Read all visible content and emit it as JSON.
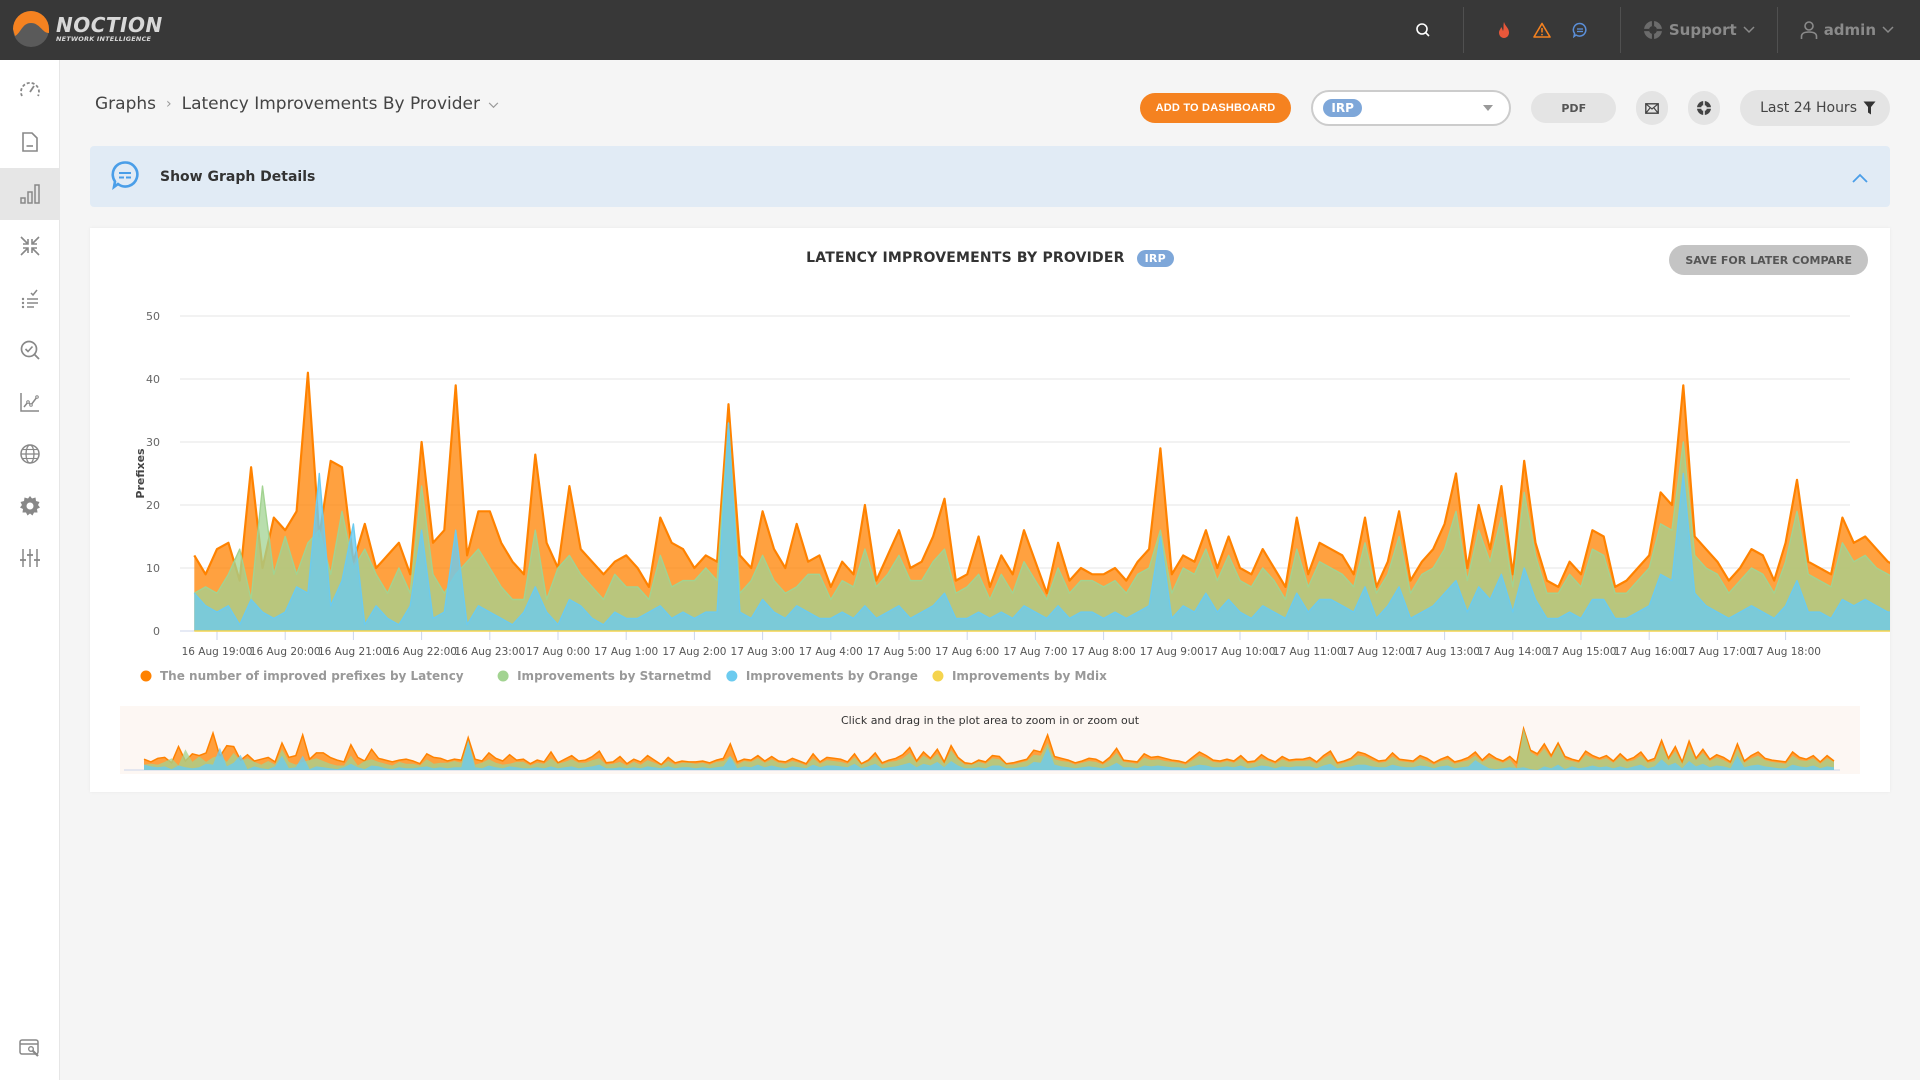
{
  "app": {
    "logo_title": "NOCTION",
    "logo_subtitle": "NETWORK INTELLIGENCE",
    "support_label": "Support",
    "user_label": "admin"
  },
  "colors": {
    "accent": "#f58220",
    "topbar": "#383838",
    "chip": "#7ea7d9",
    "series_latency": "#ff8200",
    "series_starnetmd": "#a2d391",
    "series_orange": "#6ccbef",
    "series_mdix": "#f5d44e"
  },
  "sidebar": {
    "items": [
      {
        "name": "dashboard",
        "icon": "speedometer-icon"
      },
      {
        "name": "reports",
        "icon": "document-icon"
      },
      {
        "name": "graphs",
        "icon": "bar-chart-icon",
        "active": true
      },
      {
        "name": "improvements",
        "icon": "compress-arrows-icon"
      },
      {
        "name": "events",
        "icon": "checklist-icon"
      },
      {
        "name": "search",
        "icon": "search-check-icon"
      },
      {
        "name": "trends",
        "icon": "line-chart-icon"
      },
      {
        "name": "providers",
        "icon": "globe-icon"
      },
      {
        "name": "settings",
        "icon": "gear-icon"
      },
      {
        "name": "configuration",
        "icon": "sliders-icon"
      }
    ],
    "bottom_item": {
      "name": "maintenance",
      "icon": "window-wrench-icon"
    }
  },
  "breadcrumb": {
    "root": "Graphs",
    "current": "Latency Improvements By Provider"
  },
  "toolbar": {
    "add_to_dashboard": "ADD TO DASHBOARD",
    "selected_instance": "IRP",
    "pdf": "PDF",
    "period": "Last 24 Hours"
  },
  "details": {
    "label": "Show Graph Details"
  },
  "card": {
    "title": "LATENCY IMPROVEMENTS BY PROVIDER",
    "chip": "IRP",
    "save_button": "SAVE FOR LATER COMPARE",
    "navigator_hint": "Click and drag in the plot area to zoom in or zoom out"
  },
  "chart_data": {
    "type": "area",
    "title": "LATENCY IMPROVEMENTS BY PROVIDER",
    "xlabel": "",
    "ylabel": "Prefixes",
    "ylim": [
      0,
      50
    ],
    "yticks": [
      0,
      10,
      20,
      30,
      40,
      50
    ],
    "grid": true,
    "legend_position": "bottom-left",
    "x_start": "16 Aug 18:40",
    "x_step_minutes": 10,
    "xticks": [
      "16 Aug 19:00",
      "16 Aug 20:00",
      "16 Aug 21:00",
      "16 Aug 22:00",
      "16 Aug 23:00",
      "17 Aug 0:00",
      "17 Aug 1:00",
      "17 Aug 2:00",
      "17 Aug 3:00",
      "17 Aug 4:00",
      "17 Aug 5:00",
      "17 Aug 6:00",
      "17 Aug 7:00",
      "17 Aug 8:00",
      "17 Aug 9:00",
      "17 Aug 10:00",
      "17 Aug 11:00",
      "17 Aug 12:00",
      "17 Aug 13:00",
      "17 Aug 14:00",
      "17 Aug 15:00",
      "17 Aug 16:00",
      "17 Aug 17:00",
      "17 Aug 18:00"
    ],
    "series": [
      {
        "name": "The number of improved prefixes by Latency",
        "values": [
          12,
          9,
          13,
          14,
          8,
          26,
          10,
          18,
          16,
          19,
          41,
          15,
          27,
          26,
          11,
          17,
          10,
          12,
          14,
          9,
          30,
          14,
          16,
          39,
          12,
          19,
          19,
          14,
          11,
          9,
          28,
          14,
          10,
          23,
          13,
          11,
          9,
          11,
          12,
          10,
          7,
          18,
          14,
          13,
          10,
          12,
          11,
          36,
          12,
          10,
          19,
          13,
          10,
          17,
          11,
          12,
          7,
          11,
          9,
          20,
          8,
          12,
          16,
          10,
          11,
          15,
          21,
          8,
          9,
          15,
          7,
          12,
          9,
          16,
          11,
          6,
          14,
          8,
          10,
          9,
          9,
          10,
          8,
          11,
          13,
          29,
          9,
          12,
          11,
          16,
          10,
          15,
          10,
          9,
          13,
          10,
          7,
          18,
          9,
          14,
          13,
          12,
          9,
          18,
          7,
          11,
          19,
          8,
          11,
          13,
          17,
          25,
          10,
          20,
          13,
          23,
          9,
          27,
          14,
          8,
          7,
          11,
          9,
          16,
          15,
          7,
          8,
          10,
          12,
          22,
          20,
          39,
          15,
          13,
          11,
          8,
          10,
          13,
          12,
          8,
          14,
          24,
          11,
          10,
          9,
          18,
          14,
          15,
          13,
          11,
          10,
          8,
          14,
          20,
          16,
          11,
          10,
          12,
          10,
          16,
          9,
          10,
          17,
          12,
          9,
          15,
          11,
          12,
          12,
          14,
          9,
          16,
          21,
          8,
          10,
          13,
          20,
          18,
          14,
          10,
          11,
          19,
          12,
          11,
          10,
          16,
          13,
          8,
          12,
          15,
          9,
          11,
          14,
          20,
          11,
          18,
          13,
          10,
          15,
          8,
          46,
          22,
          18,
          29,
          16,
          30,
          15,
          12,
          10,
          21,
          16,
          13,
          16,
          10,
          18,
          11,
          14,
          20,
          10,
          13,
          33,
          13,
          26,
          9,
          32,
          13,
          23,
          12,
          17,
          14,
          9,
          29,
          10,
          16,
          20,
          13,
          11,
          10,
          9,
          20,
          14,
          12,
          16,
          9,
          16,
          10
        ]
      },
      {
        "name": "Improvements by Starnetmd",
        "values": [
          6,
          7,
          6,
          9,
          13,
          5,
          23,
          9,
          15,
          9,
          14,
          16,
          9,
          19,
          10,
          13,
          9,
          6,
          10,
          6,
          23,
          9,
          6,
          9,
          11,
          13,
          10,
          7,
          5,
          5,
          16,
          5,
          10,
          12,
          9,
          7,
          5,
          9,
          7,
          7,
          5,
          12,
          7,
          8,
          8,
          10,
          8,
          33,
          6,
          8,
          12,
          8,
          6,
          7,
          9,
          9,
          5,
          8,
          7,
          13,
          7,
          9,
          12,
          8,
          8,
          11,
          13,
          6,
          7,
          9,
          5,
          9,
          6,
          11,
          8,
          5,
          10,
          6,
          8,
          8,
          7,
          8,
          6,
          9,
          10,
          16,
          6,
          10,
          9,
          13,
          8,
          12,
          8,
          7,
          10,
          8,
          5,
          13,
          7,
          11,
          10,
          9,
          7,
          14,
          6,
          9,
          15,
          6,
          9,
          10,
          13,
          19,
          8,
          16,
          11,
          18,
          7,
          22,
          12,
          6,
          6,
          9,
          7,
          13,
          12,
          6,
          6,
          8,
          10,
          17,
          16,
          30,
          12,
          10,
          9,
          6,
          8,
          10,
          9,
          6,
          11,
          19,
          9,
          8,
          7,
          14,
          11,
          12,
          10,
          9,
          8,
          6,
          11,
          16,
          13,
          9,
          8,
          10,
          8,
          13,
          7,
          8,
          13,
          10,
          7,
          12,
          9,
          10,
          10,
          11,
          7,
          13,
          17,
          6,
          8,
          11,
          16,
          15,
          11,
          8,
          9,
          15,
          10,
          9,
          8,
          13,
          10,
          6,
          10,
          12,
          7,
          9,
          11,
          16,
          9,
          14,
          11,
          8,
          12,
          2,
          46,
          20,
          15,
          24,
          13,
          28,
          12,
          10,
          8,
          17,
          13,
          11,
          13,
          8,
          15,
          9,
          11,
          16,
          8,
          10,
          28,
          11,
          21,
          7,
          27,
          11,
          19,
          10,
          14,
          11,
          7,
          24,
          8,
          13,
          16,
          11,
          9,
          8,
          7,
          16,
          11,
          10,
          13,
          7,
          13,
          9
        ]
      },
      {
        "name": "Improvements by Orange",
        "values": [
          6,
          4,
          3,
          4,
          1,
          5,
          3,
          2,
          3,
          7,
          6,
          25,
          4,
          8,
          17,
          1,
          4,
          2,
          1,
          4,
          16,
          2,
          3,
          16,
          1,
          4,
          3,
          2,
          1,
          3,
          7,
          3,
          1,
          5,
          4,
          2,
          1,
          3,
          2,
          2,
          3,
          4,
          2,
          3,
          2,
          3,
          3,
          33,
          3,
          2,
          5,
          3,
          2,
          4,
          3,
          2,
          2,
          3,
          2,
          4,
          2,
          3,
          4,
          2,
          3,
          4,
          6,
          2,
          2,
          3,
          2,
          3,
          2,
          4,
          3,
          2,
          4,
          2,
          3,
          3,
          2,
          3,
          2,
          3,
          4,
          15,
          2,
          4,
          3,
          6,
          3,
          5,
          3,
          2,
          4,
          3,
          2,
          6,
          3,
          5,
          5,
          4,
          3,
          7,
          2,
          4,
          7,
          2,
          3,
          4,
          6,
          8,
          3,
          7,
          5,
          9,
          3,
          10,
          5,
          2,
          2,
          3,
          2,
          5,
          5,
          2,
          2,
          3,
          4,
          9,
          8,
          25,
          6,
          4,
          3,
          2,
          3,
          4,
          3,
          2,
          4,
          8,
          3,
          3,
          2,
          5,
          4,
          5,
          4,
          3,
          3,
          2,
          4,
          6,
          5,
          3,
          3,
          4,
          3,
          5,
          2,
          3,
          5,
          4,
          2,
          4,
          3,
          4,
          4,
          4,
          2,
          5,
          7,
          2,
          3,
          4,
          6,
          6,
          4,
          3,
          3,
          6,
          4,
          3,
          3,
          5,
          4,
          2,
          4,
          5,
          2,
          3,
          4,
          11,
          6,
          2,
          1,
          2,
          3,
          2,
          3,
          1,
          0,
          4,
          2,
          6,
          1,
          4,
          2,
          3,
          5,
          3,
          4,
          2,
          4,
          2,
          4,
          6,
          2,
          4,
          12,
          5,
          8,
          2,
          10,
          4,
          7,
          3,
          5,
          4,
          2,
          16,
          3,
          5,
          6,
          4,
          3,
          2,
          2,
          6,
          4,
          3,
          5,
          2,
          4,
          3
        ]
      },
      {
        "name": "Improvements by Mdix",
        "values": [
          0,
          0,
          0,
          0,
          0,
          0,
          0,
          0,
          0,
          0,
          0,
          0,
          0,
          0,
          0,
          0,
          0,
          0,
          0,
          0,
          0,
          0,
          0,
          0,
          0,
          0,
          0,
          0,
          0,
          0,
          0,
          0,
          0,
          0,
          0,
          0,
          0,
          0,
          0,
          0,
          0,
          0,
          0,
          0,
          0,
          0,
          0,
          0,
          0,
          0,
          0,
          0,
          0,
          0,
          0,
          0,
          0,
          0,
          0,
          0,
          0,
          0,
          0,
          0,
          0,
          0,
          0,
          0,
          0,
          0,
          0,
          0,
          0,
          0,
          0,
          0,
          0,
          0,
          0,
          0,
          0,
          0,
          0,
          0,
          0,
          0,
          0,
          0,
          0,
          0,
          0,
          0,
          0,
          0,
          0,
          0,
          0,
          0,
          0,
          0,
          0,
          0,
          0,
          0,
          0,
          0,
          0,
          0,
          0,
          0,
          0,
          0,
          0,
          0,
          0,
          0,
          0,
          0,
          0,
          0,
          0,
          0,
          0,
          0,
          0,
          0,
          0,
          0,
          0,
          0,
          0,
          0,
          0,
          0,
          0,
          0,
          0,
          0,
          0,
          0,
          0,
          0,
          0,
          0,
          0,
          0,
          0,
          0,
          0,
          0,
          0,
          0,
          0,
          0,
          0,
          0,
          0,
          0,
          0,
          0,
          0,
          0,
          0,
          0,
          0,
          0,
          0,
          0,
          0,
          0,
          0,
          0,
          0,
          0,
          0,
          0,
          0,
          0,
          0,
          0,
          0,
          0,
          0,
          0,
          0,
          0,
          0,
          0,
          0,
          0,
          0,
          0,
          0,
          0,
          0,
          0,
          0,
          0,
          0,
          0,
          0,
          0,
          0,
          0,
          0,
          0,
          0,
          0,
          0,
          0,
          0,
          0,
          0,
          0,
          0,
          0,
          0,
          0,
          0,
          0,
          0,
          0,
          0,
          0,
          0,
          0,
          0,
          0,
          0,
          0,
          0,
          0,
          0,
          0,
          0,
          0,
          0,
          0,
          0,
          0,
          0,
          0,
          0,
          0,
          0,
          0,
          0,
          0,
          0,
          0,
          0,
          0,
          0,
          0,
          0,
          0
        ]
      }
    ]
  }
}
